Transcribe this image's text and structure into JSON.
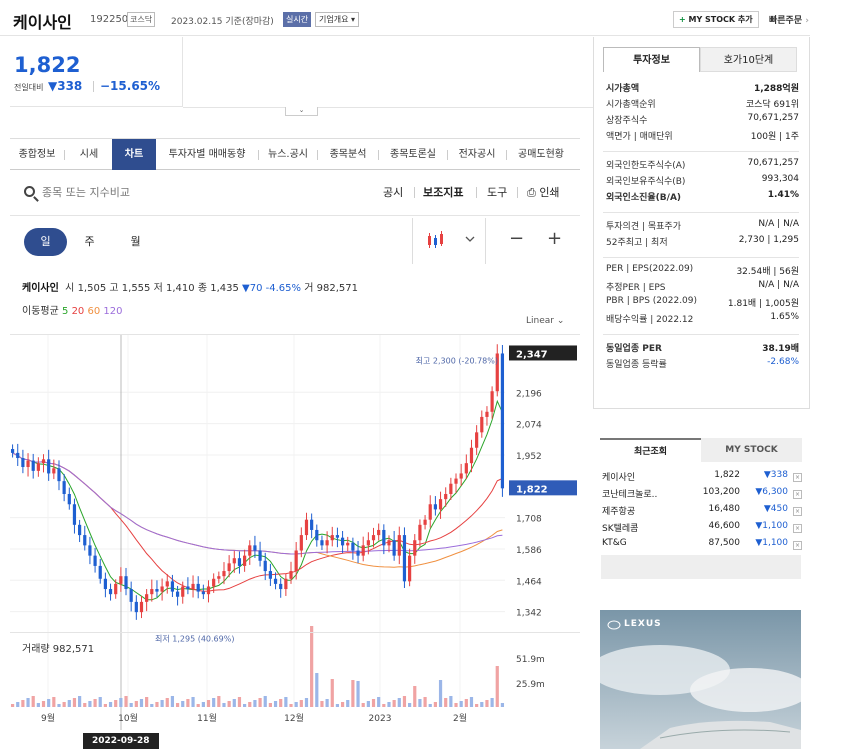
{
  "header": {
    "name": "케이사인",
    "code": "192250",
    "market": "코스닥",
    "date": "2023.02.15 기준(장마감)",
    "realtime": "실시간",
    "corp_info": "기업개요",
    "my_stock": "MY STOCK 추가",
    "quick_order": "빠른주문"
  },
  "price": {
    "current": "1,822",
    "prev_label": "전일대비",
    "change": "338",
    "change_pct": "−15.65%"
  },
  "tabs": [
    "종합정보",
    "시세",
    "차트",
    "투자자별 매매동향",
    "뉴스.공시",
    "종목분석",
    "종목토론실",
    "전자공시",
    "공매도현황"
  ],
  "search": {
    "placeholder": "종목 또는 지수비교"
  },
  "tools": [
    "공시",
    "보조지표",
    "도구",
    "인쇄"
  ],
  "periods": [
    "일",
    "주",
    "월"
  ],
  "ohlc": {
    "name": "케이사인",
    "open_label": "시",
    "open": "1,505",
    "high_label": "고",
    "high": "1,555",
    "low_label": "저",
    "low": "1,410",
    "close_label": "종",
    "close": "1,435",
    "change": "▼70",
    "pct": "-4.65%",
    "vol_label": "거",
    "vol": "982,571"
  },
  "ma": {
    "label": "이동평균",
    "p5": "5",
    "p20": "20",
    "p60": "60",
    "p120": "120"
  },
  "scale": "Linear",
  "chart_data": {
    "type": "candlestick",
    "y_ticks": [
      2196,
      2074,
      1952,
      1708,
      1586,
      1464,
      1342
    ],
    "ylim": [
      1290,
      2380
    ],
    "x_ticks": [
      "9월",
      "10월",
      "11월",
      "12월",
      "2023",
      "2월"
    ],
    "last_price": 2347,
    "current_price": 1822,
    "max_label": "최고 2,300 (-20.78%)",
    "min_label": "최저 1,295 (40.69%)",
    "volume_label": "거래량 982,571",
    "volume_ticks": [
      "51.9m",
      "25.9m"
    ],
    "closes": [
      1960,
      1940,
      1905,
      1930,
      1890,
      1920,
      1935,
      1880,
      1900,
      1850,
      1800,
      1760,
      1680,
      1640,
      1600,
      1560,
      1520,
      1470,
      1430,
      1410,
      1450,
      1480,
      1430,
      1380,
      1340,
      1380,
      1410,
      1430,
      1420,
      1440,
      1460,
      1420,
      1400,
      1440,
      1430,
      1450,
      1420,
      1410,
      1440,
      1470,
      1480,
      1500,
      1530,
      1550,
      1520,
      1560,
      1600,
      1580,
      1540,
      1500,
      1470,
      1450,
      1430,
      1470,
      1500,
      1580,
      1640,
      1700,
      1660,
      1620,
      1600,
      1620,
      1640,
      1630,
      1600,
      1610,
      1580,
      1560,
      1600,
      1620,
      1640,
      1660,
      1600,
      1620,
      1560,
      1640,
      1460,
      1560,
      1620,
      1680,
      1700,
      1760,
      1740,
      1780,
      1800,
      1840,
      1860,
      1880,
      1920,
      1980,
      2040,
      2100,
      2120,
      2200,
      2347,
      1822
    ]
  },
  "sidebar": {
    "tab1": "투자정보",
    "tab2": "호가10단계",
    "g1": [
      [
        "시가총액",
        "1,288억원"
      ],
      [
        "시가총액순위",
        "코스닥 691위"
      ],
      [
        "상장주식수",
        "70,671,257"
      ],
      [
        "액면가 | 매매단위",
        "100원 | 1주"
      ]
    ],
    "g2": [
      [
        "외국인한도주식수(A)",
        "70,671,257"
      ],
      [
        "외국인보유주식수(B)",
        "993,304"
      ],
      [
        "외국인소진율(B/A)",
        "1.41%"
      ]
    ],
    "g3": [
      [
        "투자의견 | 목표주가",
        "N/A | N/A"
      ],
      [
        "52주최고 | 최저",
        "2,730 | 1,295"
      ]
    ],
    "g4": [
      [
        "PER | EPS(2022.09)",
        "32.54배 | 56원"
      ],
      [
        "추정PER | EPS",
        "N/A | N/A"
      ],
      [
        "PBR | BPS (2022.09)",
        "1.81배 | 1,005원"
      ],
      [
        "배당수익률 | 2022.12",
        "1.65%"
      ]
    ],
    "g5": [
      [
        "동일업종 PER",
        "38.19배"
      ],
      [
        "동일업종 등락률",
        "-2.68%"
      ]
    ]
  },
  "recent": {
    "tab1": "최근조회",
    "tab2": "MY STOCK",
    "items": [
      [
        "케이사인",
        "1,822",
        "▼338"
      ],
      [
        "코난테크놀로..",
        "103,200",
        "▼6,300"
      ],
      [
        "제주항공",
        "16,480",
        "▼450"
      ],
      [
        "SK텔레콤",
        "46,600",
        "▼1,100"
      ],
      [
        "KT&G",
        "87,500",
        "▼1,100"
      ]
    ]
  },
  "ad": {
    "brand": "LEXUS"
  },
  "crosshair_date": "2022-09-28"
}
